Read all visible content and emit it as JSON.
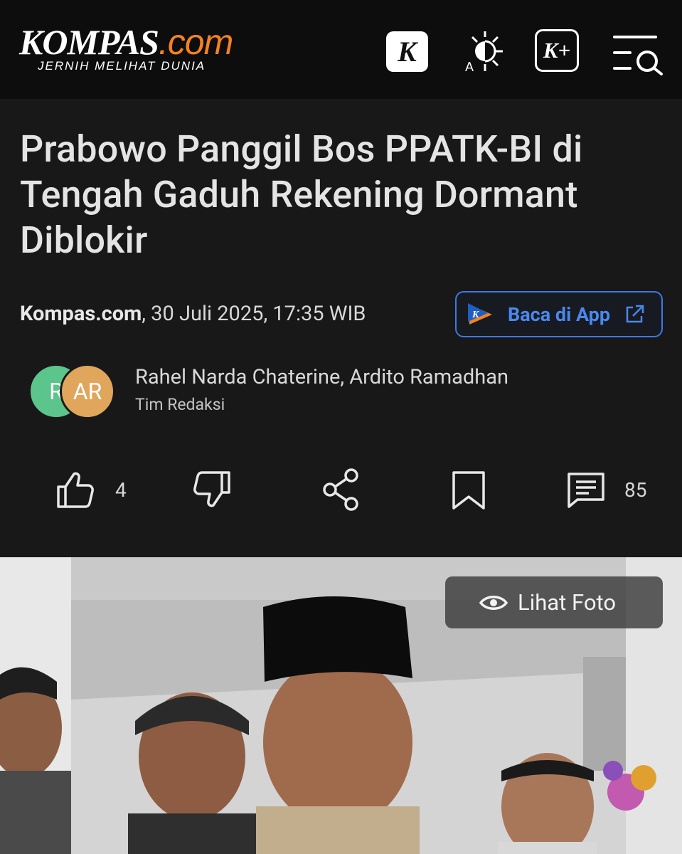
{
  "header": {
    "logo_main": "KOMPAS",
    "logo_suffix": ".com",
    "tagline": "JERNIH MELIHAT DUNIA",
    "k_badge": "K",
    "kplus_badge": "K+",
    "icons": [
      "kompas-k-icon",
      "theme-toggle-icon",
      "kompas-plus-icon",
      "menu-search-icon"
    ]
  },
  "article": {
    "title": "Prabowo Panggil Bos PPATK-BI di Tengah Gaduh Rekening Dormant Diblokir",
    "source": "Kompas.com",
    "datetime": ", 30 Juli 2025, 17:35 WIB",
    "app_button_label": "Baca di App",
    "authors": {
      "avatar_1": "R",
      "avatar_2": "AR",
      "names": "Rahel Narda Chaterine,  Ardito Ramadhan",
      "team": "Tim Redaksi"
    }
  },
  "actions": {
    "like_count": "4",
    "comment_count": "85"
  },
  "photo": {
    "view_label": "Lihat Foto"
  },
  "colors": {
    "background": "#181818",
    "header": "#0d0d0d",
    "brand_orange": "#f5821f",
    "link_blue": "#3b7ae6",
    "avatar_green": "#5bc58c",
    "avatar_orange": "#e0a65c"
  }
}
